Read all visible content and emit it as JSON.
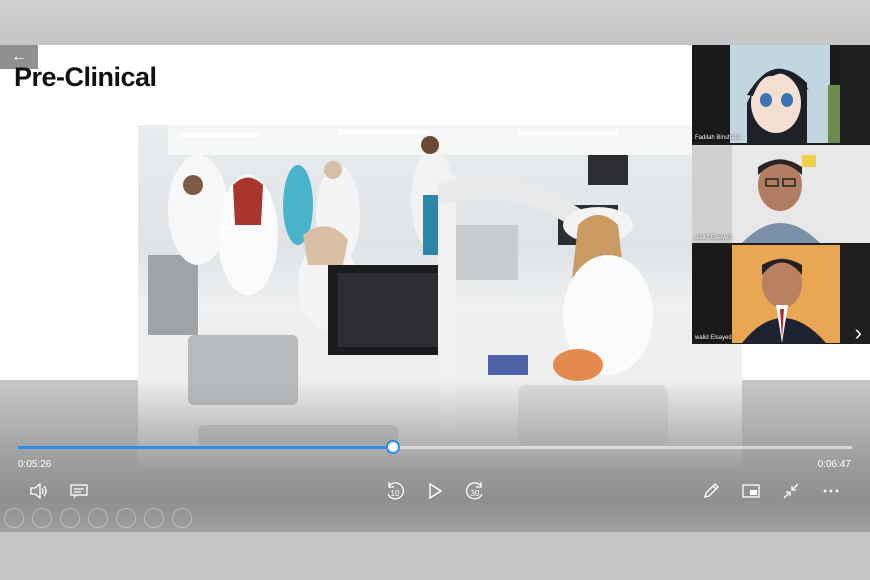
{
  "slide": {
    "title": "Pre-Clinical",
    "back_icon": "arrow-left-icon"
  },
  "participants": [
    {
      "name": "Fadilah Binshafia"
    },
    {
      "name": "walid Elsayed"
    },
    {
      "name": "walid Elsayed"
    }
  ],
  "player": {
    "elapsed": "0:05:26",
    "duration": "0:06:47",
    "progress": 0.4496,
    "accent": "#2f8de4",
    "skip_back": "10",
    "skip_forward": "30"
  }
}
